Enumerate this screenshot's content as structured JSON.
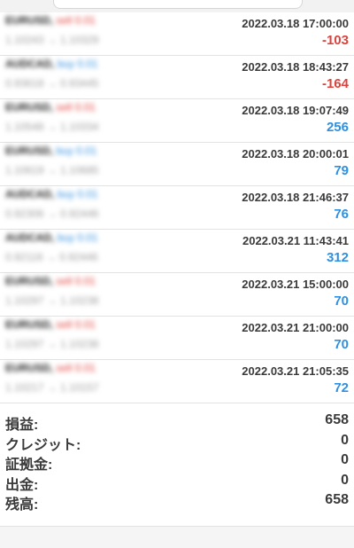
{
  "trades": [
    {
      "symbol": "EURUSD,",
      "side": "sell 0.01",
      "prices": "1.10243 → 1.10329",
      "time": "2022.03.18 17:00:00",
      "profit": "-103",
      "sign": "neg",
      "sideClass": "sell"
    },
    {
      "symbol": "AUDCAD,",
      "side": "buy 0.01",
      "prices": "0.93618 → 0.93445",
      "time": "2022.03.18 18:43:27",
      "profit": "-164",
      "sign": "neg",
      "sideClass": "buy"
    },
    {
      "symbol": "EURUSD,",
      "side": "sell 0.01",
      "prices": "1.10548 → 1.10334",
      "time": "2022.03.18 19:07:49",
      "profit": "256",
      "sign": "pos",
      "sideClass": "sell"
    },
    {
      "symbol": "EURUSD,",
      "side": "buy 0.01",
      "prices": "1.10619 → 1.10685",
      "time": "2022.03.18 20:00:01",
      "profit": "79",
      "sign": "pos",
      "sideClass": "buy"
    },
    {
      "symbol": "AUDCAD,",
      "side": "buy 0.01",
      "prices": "0.92306 → 0.92446",
      "time": "2022.03.18 21:46:37",
      "profit": "76",
      "sign": "pos",
      "sideClass": "buy"
    },
    {
      "symbol": "AUDCAD,",
      "side": "buy 0.01",
      "prices": "0.92116 → 0.92446",
      "time": "2022.03.21 11:43:41",
      "profit": "312",
      "sign": "pos",
      "sideClass": "buy"
    },
    {
      "symbol": "EURUSD,",
      "side": "sell 0.01",
      "prices": "1.10297 → 1.10238",
      "time": "2022.03.21 15:00:00",
      "profit": "70",
      "sign": "pos",
      "sideClass": "sell"
    },
    {
      "symbol": "EURUSD,",
      "side": "sell 0.01",
      "prices": "1.10297 → 1.10238",
      "time": "2022.03.21 21:00:00",
      "profit": "70",
      "sign": "pos",
      "sideClass": "sell"
    },
    {
      "symbol": "EURUSD,",
      "side": "sell 0.01",
      "prices": "1.10217 → 1.10157",
      "time": "2022.03.21 21:05:35",
      "profit": "72",
      "sign": "pos",
      "sideClass": "sell"
    }
  ],
  "summary": [
    {
      "label": "損益:",
      "value": "658"
    },
    {
      "label": "クレジット:",
      "value": "0"
    },
    {
      "label": "証拠金:",
      "value": "0"
    },
    {
      "label": "出金:",
      "value": "0"
    },
    {
      "label": "残高:",
      "value": "658"
    }
  ],
  "colors": {
    "negative": "#e0403a",
    "positive": "#2f8fe0",
    "sell": "#e0403a",
    "buy": "#2f8fe0"
  }
}
